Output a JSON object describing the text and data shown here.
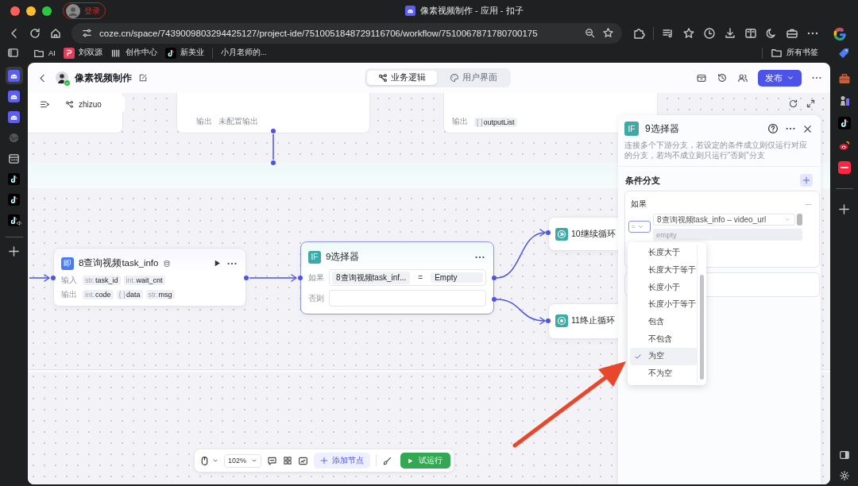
{
  "browser": {
    "profile_button": "登录",
    "tab_title": "像素视频制作 - 应用 - 扣子",
    "url": "coze.cn/space/7439009803294425127/project-ide/7510051848729116706/workflow/7510067871780700175",
    "bookmarks": [
      {
        "kind": "folder",
        "label": "AI"
      },
      {
        "kind": "app",
        "label": "刘双源"
      },
      {
        "kind": "bars",
        "label": "创作中心"
      },
      {
        "kind": "tiktok",
        "label": "新美业"
      },
      {
        "kind": "plain",
        "label": "小月老师的..."
      }
    ],
    "all_bookmarks": "所有书签"
  },
  "left_sidebar": [
    {
      "kind": "coze",
      "selected": true
    },
    {
      "kind": "coze",
      "selected": false
    },
    {
      "kind": "coze",
      "selected": false
    },
    {
      "kind": "globe",
      "selected": false
    },
    {
      "kind": "calendar",
      "selected": false
    },
    {
      "kind": "tiktok",
      "selected": false
    },
    {
      "kind": "tiktok",
      "selected": false
    },
    {
      "kind": "tiktok-sound",
      "selected": false
    }
  ],
  "app": {
    "title": "像素视频制作",
    "tabs": [
      {
        "kind": "logic",
        "label": "业务逻辑",
        "selected": true
      },
      {
        "kind": "ui",
        "label": "用户界面",
        "selected": false
      }
    ],
    "publish_button": "发布",
    "workflow_name": "zhizuo"
  },
  "canvas": {
    "partial_nodes": [
      {
        "kind": "empty"
      },
      {
        "kind": "output",
        "label": "输出",
        "value": "未配置输出"
      },
      {
        "kind": "output",
        "label": "输出",
        "type": "[ ]",
        "value": "outputList"
      }
    ],
    "nodes": [
      {
        "kind": "code",
        "icon": "即",
        "title": "8查询视频task_info",
        "rows": [
          {
            "label": "输入",
            "params": [
              {
                "type": "str.",
                "name": "task_id"
              },
              {
                "type": "int.",
                "name": "wait_cnt"
              }
            ]
          },
          {
            "label": "输出",
            "params": [
              {
                "type": "int.",
                "name": "code"
              },
              {
                "type": "{ }",
                "name": "data"
              },
              {
                "type": "str.",
                "name": "msg"
              }
            ]
          }
        ]
      },
      {
        "kind": "if",
        "selected": true,
        "icon": "IF",
        "title": "9选择器",
        "branches": [
          {
            "label": "如果",
            "left": "8查询视频task_inf...",
            "operator": "=",
            "right": "Empty"
          },
          {
            "label": "否则"
          }
        ]
      },
      {
        "kind": "continue",
        "title": "10继续循环"
      },
      {
        "kind": "stop",
        "title": "11终止循环"
      }
    ]
  },
  "panel": {
    "icon": "IF",
    "title": "9选择器",
    "description": "连接多个下游分支，若设定的条件成立则仅运行对应的分支，若均不成立则只运行“否则”分支",
    "section": "条件分支",
    "branch_label": "如果",
    "operator": "=",
    "left_value": "8查询视频task_info – video_url",
    "right_placeholder": "empty",
    "operator_options": [
      {
        "label": "长度大于",
        "selected": false
      },
      {
        "label": "长度大于等于",
        "selected": false
      },
      {
        "label": "长度小于",
        "selected": false
      },
      {
        "label": "长度小于等于",
        "selected": false
      },
      {
        "label": "包含",
        "selected": false
      },
      {
        "label": "不包含",
        "selected": false
      },
      {
        "label": "为空",
        "selected": true
      },
      {
        "label": "不为空",
        "selected": false
      }
    ]
  },
  "bottom_toolbar": {
    "zoom": "102%",
    "add_node": "添加节点",
    "test_run": "试运行"
  }
}
